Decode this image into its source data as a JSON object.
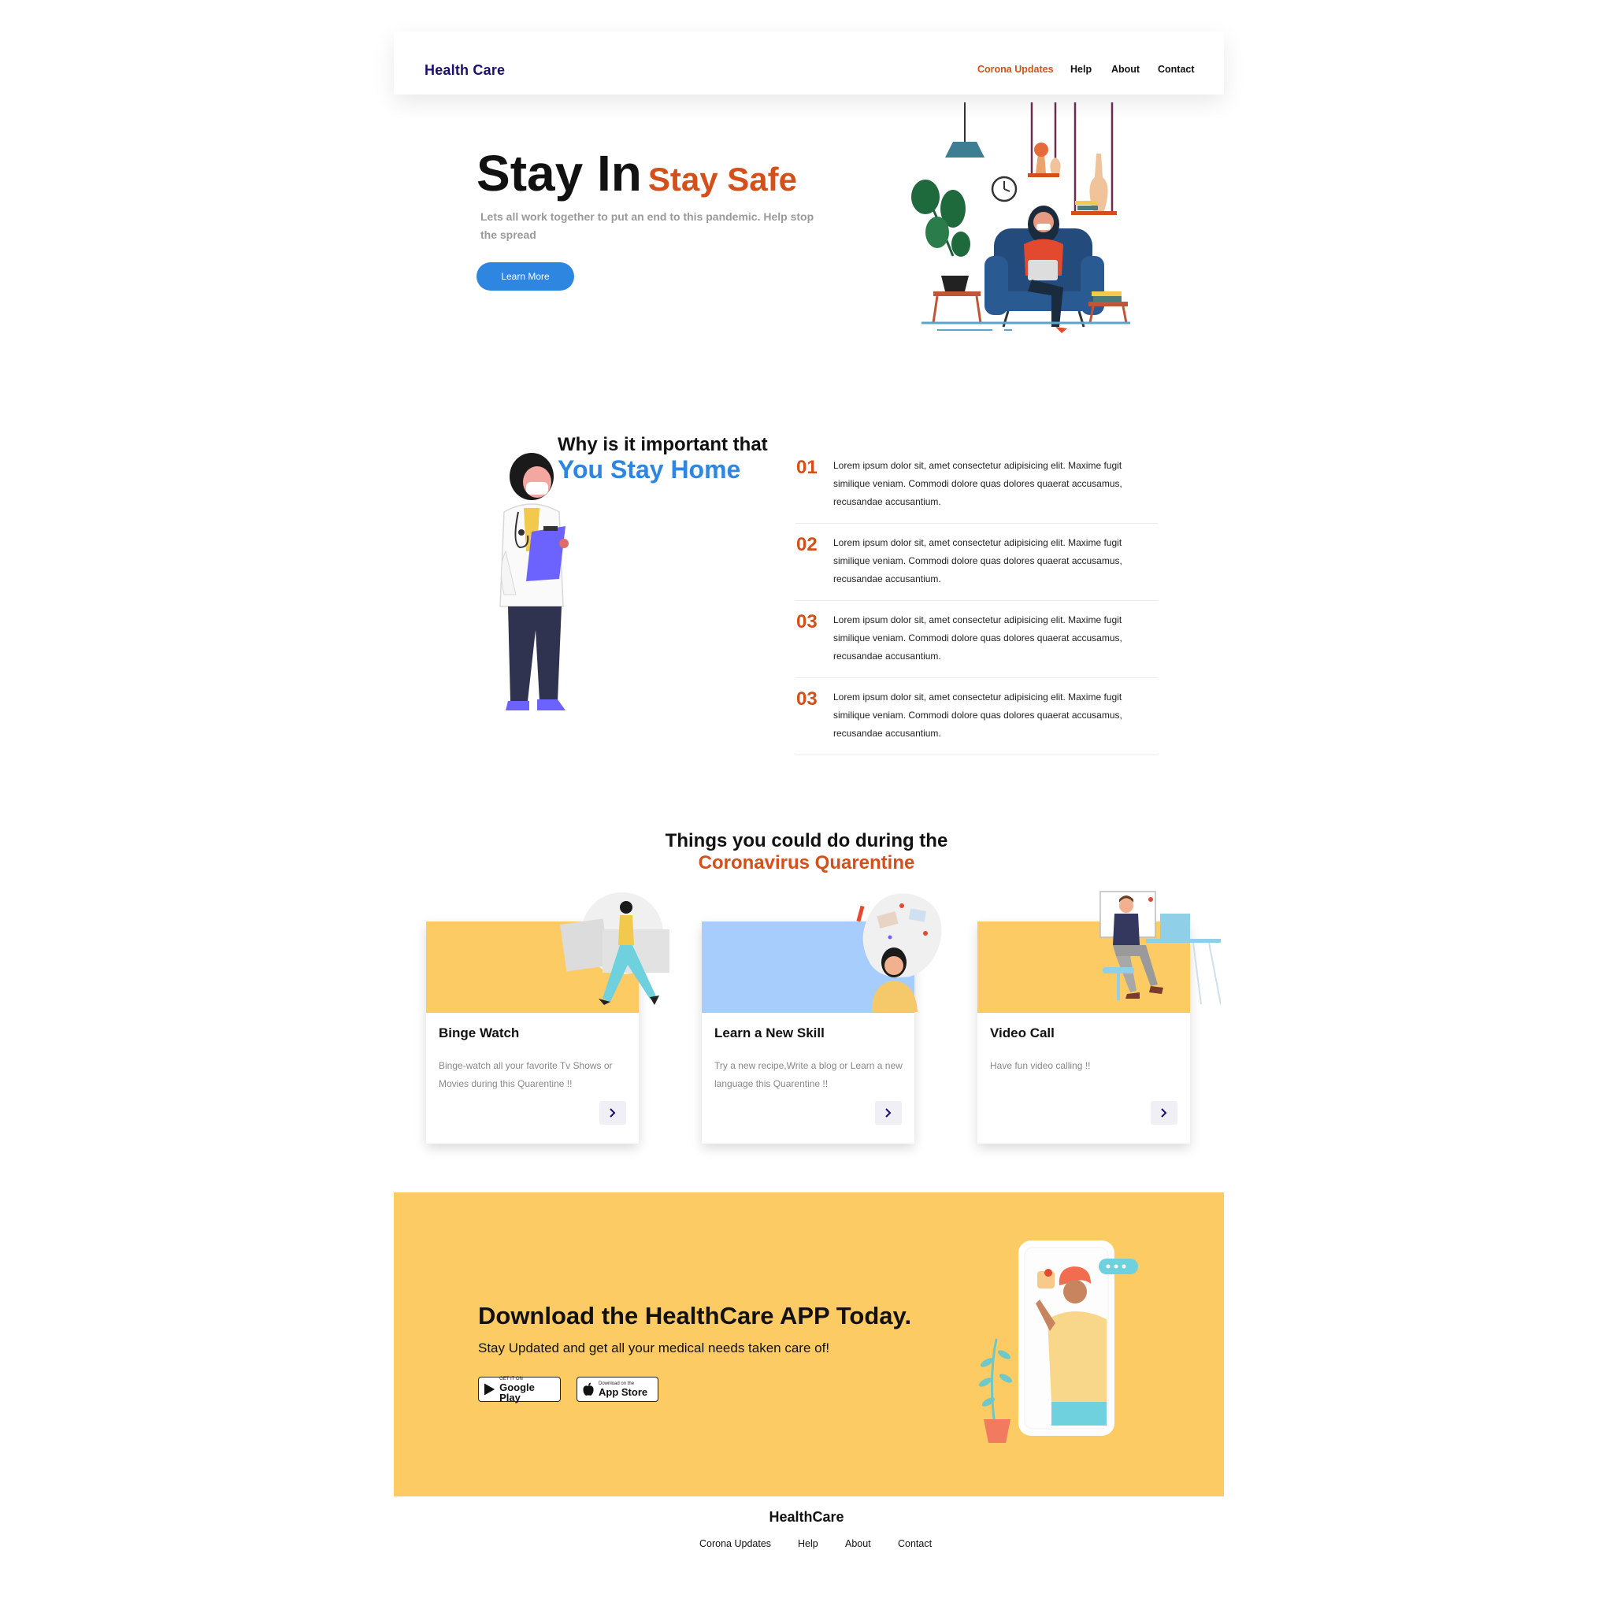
{
  "header": {
    "brand": "Health Care",
    "nav": [
      "Corona Updates",
      "Help",
      "About",
      "Contact"
    ]
  },
  "hero": {
    "title": "Stay In",
    "title_accent": "Stay Safe",
    "subtitle": "Lets all work together to put an end to this pandemic. Help stop the spread",
    "button": "Learn More"
  },
  "why": {
    "title": "Why is it important that",
    "title_accent": "You Stay Home",
    "items": [
      {
        "num": "01",
        "text": "Lorem ipsum dolor sit, amet consectetur adipisicing elit. Maxime fugit similique veniam. Commodi dolore quas dolores quaerat accusamus, recusandae accusantium."
      },
      {
        "num": "02",
        "text": "Lorem ipsum dolor sit, amet consectetur adipisicing elit. Maxime fugit similique veniam. Commodi dolore quas dolores quaerat accusamus, recusandae accusantium."
      },
      {
        "num": "03",
        "text": "Lorem ipsum dolor sit, amet consectetur adipisicing elit. Maxime fugit similique veniam. Commodi dolore quas dolores quaerat accusamus, recusandae accusantium."
      },
      {
        "num": "03",
        "text": "Lorem ipsum dolor sit, amet consectetur adipisicing elit. Maxime fugit similique veniam. Commodi dolore quas dolores quaerat accusamus, recusandae accusantium."
      }
    ]
  },
  "things": {
    "title": "Things you could do during the",
    "title_accent": "Coronavirus Quarentine",
    "cards": [
      {
        "title": "Binge Watch",
        "text": "Binge-watch all your favorite Tv Shows or Movies during this Quarentine !!",
        "color": "#fdcb63"
      },
      {
        "title": "Learn a New Skill",
        "text": "Try a new recipe,Write a blog or Learn a new language this Quarentine !!",
        "color": "#a7cdfc"
      },
      {
        "title": "Video Call",
        "text": "Have fun video calling !!",
        "color": "#fdcb63"
      }
    ]
  },
  "download": {
    "title": "Download the HealthCare APP Today.",
    "subtitle": "Stay Updated and get all your medical needs taken care of!",
    "google_small": "GET IT ON",
    "google_big": "Google Play",
    "apple_small": "Download on the",
    "apple_big": "App Store"
  },
  "footer": {
    "brand": "HealthCare",
    "links": [
      "Corona Updates",
      "Help",
      "About",
      "Contact"
    ]
  },
  "colors": {
    "accent_orange": "#d4501a",
    "accent_blue": "#2f86e0",
    "brand_navy": "#1a0f6b",
    "band_yellow": "#fdcb63"
  }
}
